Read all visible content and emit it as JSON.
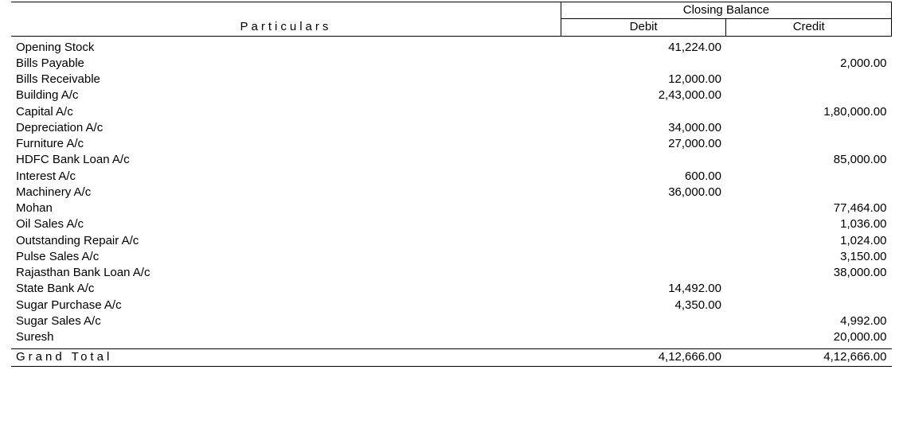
{
  "headers": {
    "particulars": "Particulars",
    "closing_balance": "Closing Balance",
    "debit": "Debit",
    "credit": "Credit"
  },
  "rows": [
    {
      "particulars": "Opening Stock",
      "debit": "41,224.00",
      "credit": ""
    },
    {
      "particulars": "Bills Payable",
      "debit": "",
      "credit": "2,000.00"
    },
    {
      "particulars": "Bills Receivable",
      "debit": "12,000.00",
      "credit": ""
    },
    {
      "particulars": "Building A/c",
      "debit": "2,43,000.00",
      "credit": ""
    },
    {
      "particulars": "Capital A/c",
      "debit": "",
      "credit": "1,80,000.00"
    },
    {
      "particulars": "Depreciation A/c",
      "debit": "34,000.00",
      "credit": ""
    },
    {
      "particulars": "Furniture A/c",
      "debit": "27,000.00",
      "credit": ""
    },
    {
      "particulars": "HDFC Bank Loan A/c",
      "debit": "",
      "credit": "85,000.00"
    },
    {
      "particulars": "Interest A/c",
      "debit": "600.00",
      "credit": ""
    },
    {
      "particulars": "Machinery A/c",
      "debit": "36,000.00",
      "credit": ""
    },
    {
      "particulars": "Mohan",
      "debit": "",
      "credit": "77,464.00"
    },
    {
      "particulars": "Oil Sales A/c",
      "debit": "",
      "credit": "1,036.00"
    },
    {
      "particulars": "Outstanding Repair A/c",
      "debit": "",
      "credit": "1,024.00"
    },
    {
      "particulars": "Pulse Sales A/c",
      "debit": "",
      "credit": "3,150.00"
    },
    {
      "particulars": "Rajasthan Bank Loan A/c",
      "debit": "",
      "credit": "38,000.00"
    },
    {
      "particulars": "State Bank A/c",
      "debit": "14,492.00",
      "credit": ""
    },
    {
      "particulars": "Sugar Purchase A/c",
      "debit": "4,350.00",
      "credit": ""
    },
    {
      "particulars": "Sugar Sales A/c",
      "debit": "",
      "credit": "4,992.00"
    },
    {
      "particulars": "Suresh",
      "debit": "",
      "credit": "20,000.00"
    }
  ],
  "grand_total": {
    "label": "Grand Total",
    "debit": "4,12,666.00",
    "credit": "4,12,666.00"
  },
  "chart_data": {
    "type": "table",
    "title": "Closing Balance",
    "columns": [
      "Particulars",
      "Debit",
      "Credit"
    ],
    "rows": [
      [
        "Opening Stock",
        41224.0,
        null
      ],
      [
        "Bills Payable",
        null,
        2000.0
      ],
      [
        "Bills Receivable",
        12000.0,
        null
      ],
      [
        "Building A/c",
        243000.0,
        null
      ],
      [
        "Capital A/c",
        null,
        180000.0
      ],
      [
        "Depreciation A/c",
        34000.0,
        null
      ],
      [
        "Furniture A/c",
        27000.0,
        null
      ],
      [
        "HDFC Bank Loan A/c",
        null,
        85000.0
      ],
      [
        "Interest A/c",
        600.0,
        null
      ],
      [
        "Machinery A/c",
        36000.0,
        null
      ],
      [
        "Mohan",
        null,
        77464.0
      ],
      [
        "Oil Sales A/c",
        null,
        1036.0
      ],
      [
        "Outstanding Repair A/c",
        null,
        1024.0
      ],
      [
        "Pulse Sales A/c",
        null,
        3150.0
      ],
      [
        "Rajasthan Bank Loan A/c",
        null,
        38000.0
      ],
      [
        "State Bank A/c",
        14492.0,
        null
      ],
      [
        "Sugar Purchase A/c",
        4350.0,
        null
      ],
      [
        "Sugar Sales A/c",
        null,
        4992.0
      ],
      [
        "Suresh",
        null,
        20000.0
      ]
    ],
    "totals": {
      "debit": 412666.0,
      "credit": 412666.0
    }
  }
}
